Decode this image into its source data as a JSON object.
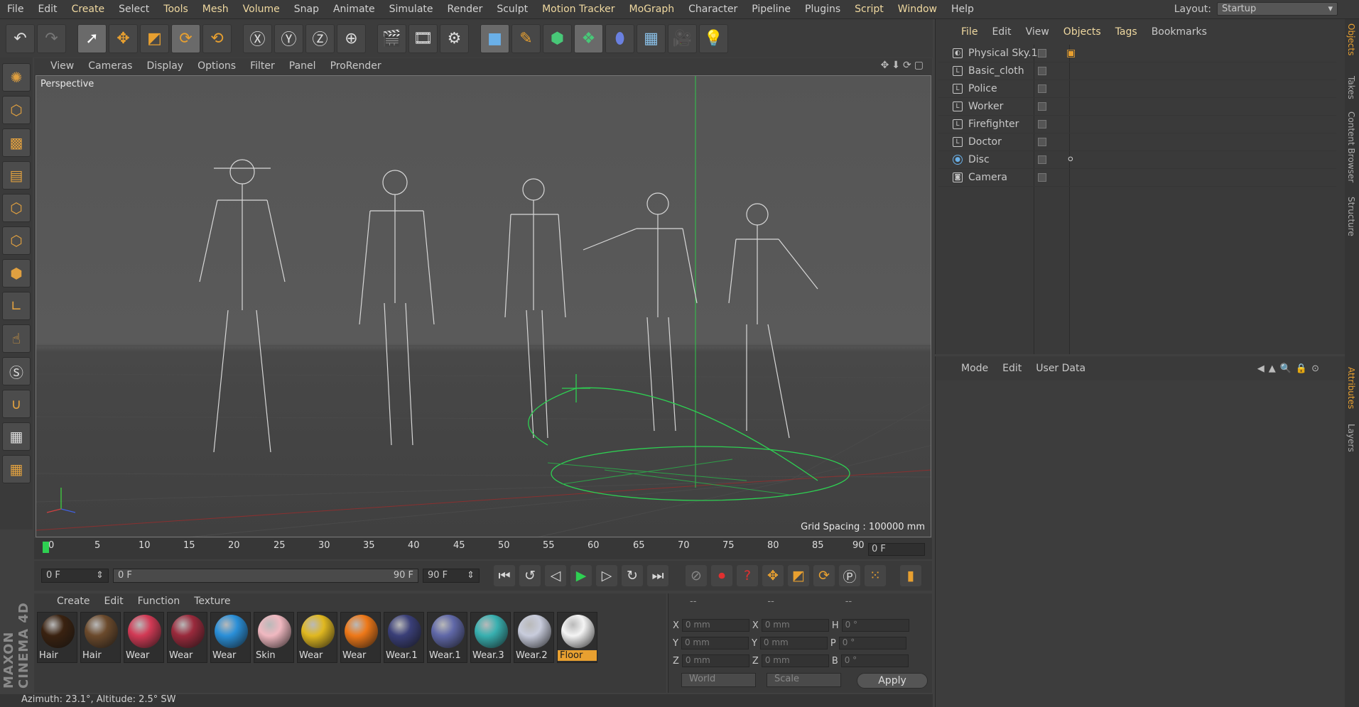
{
  "menubar": {
    "items": [
      "File",
      "Edit",
      "Create",
      "Select",
      "Tools",
      "Mesh",
      "Volume",
      "Snap",
      "Animate",
      "Simulate",
      "Render",
      "Sculpt",
      "Motion Tracker",
      "MoGraph",
      "Character",
      "Pipeline",
      "Plugins",
      "Script",
      "Window",
      "Help"
    ],
    "layout_label": "Layout:",
    "layout_value": "Startup"
  },
  "viewport": {
    "menu": [
      "View",
      "Cameras",
      "Display",
      "Options",
      "Filter",
      "Panel",
      "ProRender"
    ],
    "label": "Perspective",
    "grid_spacing": "Grid Spacing : 100000 mm"
  },
  "timeline": {
    "ticks": [
      "0",
      "5",
      "10",
      "15",
      "20",
      "25",
      "30",
      "35",
      "40",
      "45",
      "50",
      "55",
      "60",
      "65",
      "70",
      "75",
      "80",
      "85",
      "90"
    ],
    "current_frame": "0 F"
  },
  "transport": {
    "start": "0 F",
    "range_start": "0 F",
    "range_end": "90 F",
    "end": "90 F"
  },
  "materials": {
    "menu": [
      "Create",
      "Edit",
      "Function",
      "Texture"
    ],
    "items": [
      {
        "name": "Hair",
        "color": "#3a2210"
      },
      {
        "name": "Hair",
        "color": "#6b4a2c"
      },
      {
        "name": "Wear",
        "color": "#d23a55"
      },
      {
        "name": "Wear",
        "color": "#9a2a3c"
      },
      {
        "name": "Wear",
        "color": "#2a8fd8"
      },
      {
        "name": "Skin",
        "color": "#f0b8c0"
      },
      {
        "name": "Wear",
        "color": "#e0b820"
      },
      {
        "name": "Wear",
        "color": "#ee7818"
      },
      {
        "name": "Wear.1",
        "color": "#3a3f78"
      },
      {
        "name": "Wear.1",
        "color": "#6068a8"
      },
      {
        "name": "Wear.3",
        "color": "#38b0b0"
      },
      {
        "name": "Wear.2",
        "color": "#c8ccdc"
      },
      {
        "name": "Floor",
        "color": "#f4f4f4"
      }
    ]
  },
  "coords": {
    "header": [
      "--",
      "--",
      "--"
    ],
    "rows": [
      {
        "a": "X",
        "av": "0 mm",
        "b": "X",
        "bv": "0 mm",
        "c": "H",
        "cv": "0 °"
      },
      {
        "a": "Y",
        "av": "0 mm",
        "b": "Y",
        "bv": "0 mm",
        "c": "P",
        "cv": "0 °"
      },
      {
        "a": "Z",
        "av": "0 mm",
        "b": "Z",
        "bv": "0 mm",
        "c": "B",
        "cv": "0 °"
      }
    ],
    "world": "World",
    "scale": "Scale",
    "apply": "Apply"
  },
  "objects": {
    "menu": [
      "File",
      "Edit",
      "View",
      "Objects",
      "Tags",
      "Bookmarks"
    ],
    "items": [
      "Physical Sky.1",
      "Basic_cloth",
      "Police",
      "Worker",
      "Firefighter",
      "Doctor",
      "Disc",
      "Camera"
    ]
  },
  "attributes": {
    "menu": [
      "Mode",
      "Edit",
      "User Data"
    ]
  },
  "sidetabs": [
    "Objects",
    "Takes",
    "Content Browser",
    "Structure",
    "Attributes",
    "Layers"
  ],
  "brand": "MAXON CINEMA 4D",
  "status": "Azimuth: 23.1°, Altitude: 2.5°  SW"
}
